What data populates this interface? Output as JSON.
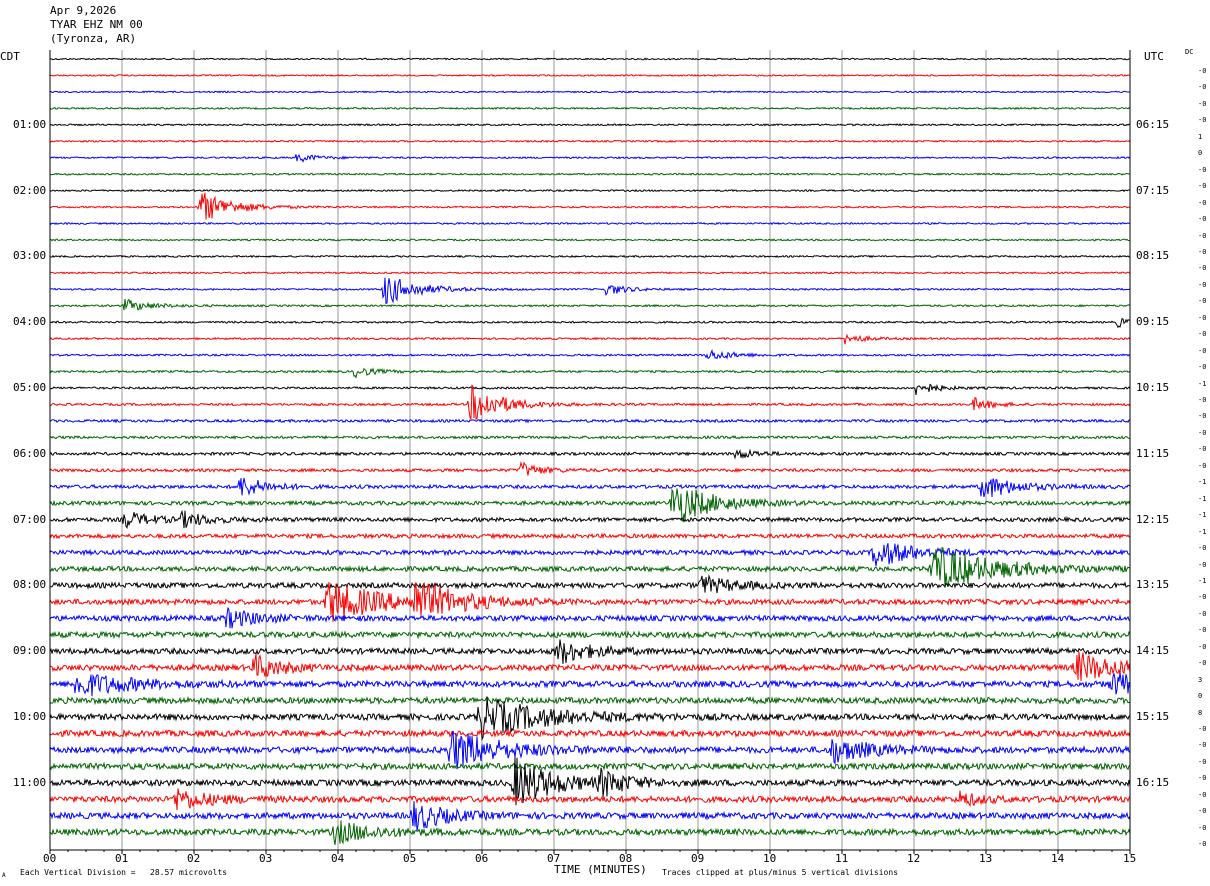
{
  "header": {
    "date": "Apr 9,2026",
    "station": "TYAR EHZ NM 00",
    "location": "(Tyronza, AR)"
  },
  "left_tz": "CDT",
  "right_tz": "UTC",
  "dc_label": "DC",
  "footer": {
    "scale": "Each Vertical Division =   28.57 microvolts",
    "xlabel": "TIME (MINUTES)",
    "clip_note": "Traces clipped at plus/minus 5 vertical divisions",
    "corner_mark": "A"
  },
  "colors": {
    "trace_cycle": [
      "#000000",
      "#ff0000",
      "#0000ff",
      "#006400"
    ],
    "grid": "#999999"
  },
  "chart_data": {
    "type": "line",
    "subtype": "helicorder",
    "xlim": [
      0,
      15
    ],
    "x_ticks": [
      "00",
      "01",
      "02",
      "03",
      "04",
      "05",
      "06",
      "07",
      "08",
      "09",
      "10",
      "11",
      "12",
      "13",
      "14",
      "15"
    ],
    "xlabel": "TIME (MINUTES)",
    "trace_count": 48,
    "trace_minutes": 15,
    "left_time_labels": [
      {
        "trace": 4,
        "label": "01:00"
      },
      {
        "trace": 8,
        "label": "02:00"
      },
      {
        "trace": 12,
        "label": "03:00"
      },
      {
        "trace": 16,
        "label": "04:00"
      },
      {
        "trace": 20,
        "label": "05:00"
      },
      {
        "trace": 24,
        "label": "06:00"
      },
      {
        "trace": 28,
        "label": "07:00"
      },
      {
        "trace": 32,
        "label": "08:00"
      },
      {
        "trace": 36,
        "label": "09:00"
      },
      {
        "trace": 40,
        "label": "10:00"
      },
      {
        "trace": 44,
        "label": "11:00"
      }
    ],
    "right_time_labels": [
      {
        "trace": 4,
        "label": "06:15"
      },
      {
        "trace": 8,
        "label": "07:15"
      },
      {
        "trace": 12,
        "label": "08:15"
      },
      {
        "trace": 16,
        "label": "09:15"
      },
      {
        "trace": 20,
        "label": "10:15"
      },
      {
        "trace": 24,
        "label": "11:15"
      },
      {
        "trace": 28,
        "label": "12:15"
      },
      {
        "trace": 32,
        "label": "13:15"
      },
      {
        "trace": 36,
        "label": "14:15"
      },
      {
        "trace": 40,
        "label": "15:15"
      },
      {
        "trace": 44,
        "label": "16:15"
      }
    ],
    "dc_offsets": [
      "-0",
      "-0",
      "-0",
      "-0",
      "1",
      "0",
      "-0",
      "-0",
      "-0",
      "-0",
      "-0",
      "-0",
      "-0",
      "-0",
      "-0",
      "-0",
      "-0",
      "-0",
      "-0",
      "-1",
      "-0",
      "-0",
      "-0",
      "-0",
      "-0",
      "-1",
      "-1",
      "-1",
      "-1",
      "-0",
      "-0",
      "-1",
      "-0",
      "-0",
      "-0",
      "-0",
      "-0",
      "3",
      "0",
      "8",
      "-0",
      "-0",
      "-0",
      "-0",
      "-0",
      "-0",
      "-0",
      "-0"
    ],
    "noise_level": [
      0.7,
      0.7,
      0.7,
      0.8,
      0.8,
      0.8,
      0.8,
      0.8,
      0.8,
      0.8,
      0.8,
      0.8,
      0.8,
      0.8,
      0.8,
      0.9,
      0.9,
      0.9,
      0.9,
      1.0,
      1.0,
      1.1,
      1.3,
      1.3,
      1.4,
      1.5,
      1.7,
      1.9,
      2.0,
      2.0,
      2.2,
      2.4,
      2.6,
      2.6,
      2.7,
      2.8,
      2.8,
      2.9,
      3.0,
      3.0,
      3.0,
      3.0,
      3.0,
      3.0,
      3.0,
      3.0,
      3.0,
      3.0
    ],
    "events": [
      {
        "trace": 9,
        "minute": 2.05,
        "amplitude": 18,
        "duration": 0.5
      },
      {
        "trace": 6,
        "minute": 3.4,
        "amplitude": 5,
        "duration": 0.3
      },
      {
        "trace": 14,
        "minute": 4.6,
        "amplitude": 18,
        "duration": 0.5
      },
      {
        "trace": 15,
        "minute": 1.0,
        "amplitude": 7,
        "duration": 0.4
      },
      {
        "trace": 14,
        "minute": 7.7,
        "amplitude": 7,
        "duration": 0.3
      },
      {
        "trace": 16,
        "minute": 14.8,
        "amplitude": 5,
        "duration": 0.3
      },
      {
        "trace": 17,
        "minute": 11.0,
        "amplitude": 6,
        "duration": 0.3
      },
      {
        "trace": 18,
        "minute": 9.1,
        "amplitude": 6,
        "duration": 0.4
      },
      {
        "trace": 19,
        "minute": 4.2,
        "amplitude": 6,
        "duration": 0.3
      },
      {
        "trace": 20,
        "minute": 12.0,
        "amplitude": 8,
        "duration": 0.3
      },
      {
        "trace": 21,
        "minute": 5.8,
        "amplitude": 22,
        "duration": 0.5
      },
      {
        "trace": 21,
        "minute": 12.8,
        "amplitude": 7,
        "duration": 0.3
      },
      {
        "trace": 24,
        "minute": 9.5,
        "amplitude": 6,
        "duration": 0.3
      },
      {
        "trace": 25,
        "minute": 6.5,
        "amplitude": 9,
        "duration": 0.3
      },
      {
        "trace": 26,
        "minute": 2.6,
        "amplitude": 12,
        "duration": 0.4
      },
      {
        "trace": 26,
        "minute": 12.9,
        "amplitude": 14,
        "duration": 0.5
      },
      {
        "trace": 27,
        "minute": 8.6,
        "amplitude": 25,
        "duration": 0.6
      },
      {
        "trace": 28,
        "minute": 1.0,
        "amplitude": 9,
        "duration": 0.4
      },
      {
        "trace": 28,
        "minute": 1.8,
        "amplitude": 8,
        "duration": 0.4
      },
      {
        "trace": 30,
        "minute": 11.4,
        "amplitude": 16,
        "duration": 0.6
      },
      {
        "trace": 31,
        "minute": 12.2,
        "amplitude": 26,
        "duration": 0.9
      },
      {
        "trace": 33,
        "minute": 3.8,
        "amplitude": 24,
        "duration": 0.8
      },
      {
        "trace": 33,
        "minute": 5.0,
        "amplitude": 22,
        "duration": 0.7
      },
      {
        "trace": 32,
        "minute": 9.0,
        "amplitude": 10,
        "duration": 0.5
      },
      {
        "trace": 34,
        "minute": 2.4,
        "amplitude": 10,
        "duration": 0.5
      },
      {
        "trace": 36,
        "minute": 7.0,
        "amplitude": 14,
        "duration": 0.5
      },
      {
        "trace": 37,
        "minute": 2.8,
        "amplitude": 14,
        "duration": 0.4
      },
      {
        "trace": 37,
        "minute": 14.2,
        "amplitude": 16,
        "duration": 0.7
      },
      {
        "trace": 38,
        "minute": 0.3,
        "amplitude": 14,
        "duration": 0.8
      },
      {
        "trace": 38,
        "minute": 14.7,
        "amplitude": 12,
        "duration": 0.6
      },
      {
        "trace": 40,
        "minute": 5.9,
        "amplitude": 22,
        "duration": 1.0
      },
      {
        "trace": 42,
        "minute": 5.5,
        "amplitude": 22,
        "duration": 0.8
      },
      {
        "trace": 42,
        "minute": 10.8,
        "amplitude": 14,
        "duration": 0.6
      },
      {
        "trace": 44,
        "minute": 6.4,
        "amplitude": 28,
        "duration": 0.6
      },
      {
        "trace": 44,
        "minute": 7.6,
        "amplitude": 14,
        "duration": 0.4
      },
      {
        "trace": 45,
        "minute": 1.7,
        "amplitude": 12,
        "duration": 0.5
      },
      {
        "trace": 45,
        "minute": 12.6,
        "amplitude": 8,
        "duration": 0.3
      },
      {
        "trace": 46,
        "minute": 5.0,
        "amplitude": 16,
        "duration": 0.5
      },
      {
        "trace": 47,
        "minute": 3.9,
        "amplitude": 12,
        "duration": 0.6
      }
    ]
  }
}
